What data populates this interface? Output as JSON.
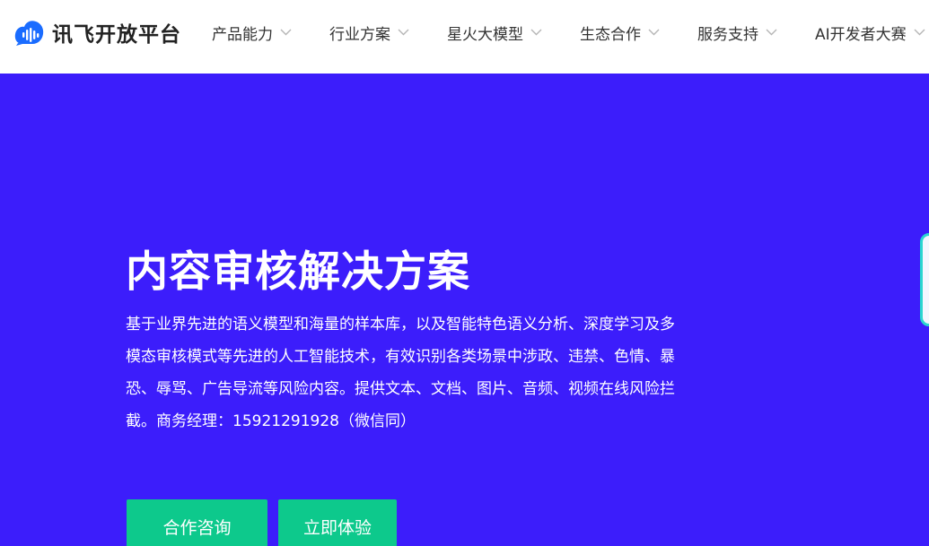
{
  "brand": {
    "name": "讯飞开放平台",
    "icon": "sound-wave-cloud-logo",
    "color": "#1a6cff"
  },
  "nav": {
    "items": [
      {
        "label": "产品能力"
      },
      {
        "label": "行业方案"
      },
      {
        "label": "星火大模型"
      },
      {
        "label": "生态合作"
      },
      {
        "label": "服务支持"
      },
      {
        "label": "AI开发者大赛"
      }
    ],
    "dropdown_icon": "chevron-down-icon"
  },
  "hero": {
    "title": "内容审核解决方案",
    "description": "基于业界先进的语义模型和海量的样本库，以及智能特色语义分析、深度学习及多模态审核模式等先进的人工智能技术，有效识别各类场景中涉政、违禁、色情、暴恐、辱骂、广告导流等风险内容。提供文本、文档、图片、音频、视频在线风险拦截。商务经理：15921291928（微信同）",
    "background_color": "#3c1dfb"
  },
  "actions": {
    "consult_label": "合作咨询",
    "try_label": "立即体验",
    "button_color": "#0dc98c"
  }
}
